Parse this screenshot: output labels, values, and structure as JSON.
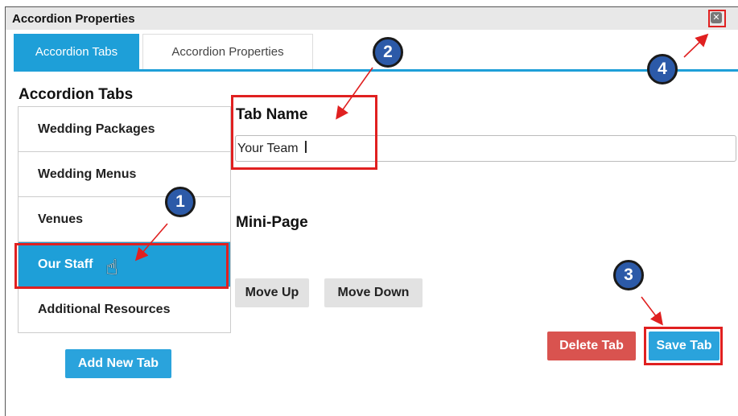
{
  "dialog": {
    "title": "Accordion Properties",
    "close_icon": "close-icon"
  },
  "tabs": [
    {
      "label": "Accordion Tabs",
      "active": true
    },
    {
      "label": "Accordion Properties",
      "active": false
    }
  ],
  "sidebar": {
    "title": "Accordion Tabs",
    "items": [
      {
        "label": "Wedding Packages",
        "selected": false
      },
      {
        "label": "Wedding Menus",
        "selected": false
      },
      {
        "label": "Venues",
        "selected": false
      },
      {
        "label": "Our Staff",
        "selected": true
      },
      {
        "label": "Additional Resources",
        "selected": false
      }
    ],
    "add_button": "Add New Tab"
  },
  "form": {
    "tab_name_label": "Tab Name",
    "tab_name_value": "Your Team",
    "mini_page_label": "Mini-Page",
    "move_up": "Move Up",
    "move_down": "Move Down",
    "delete_tab": "Delete Tab",
    "save_tab": "Save Tab"
  },
  "callouts": [
    "1",
    "2",
    "3",
    "4"
  ],
  "colors": {
    "accent": "#1e9fd8",
    "danger": "#d9534f",
    "highlight": "#e02020",
    "badge": "#2c5aa8"
  }
}
